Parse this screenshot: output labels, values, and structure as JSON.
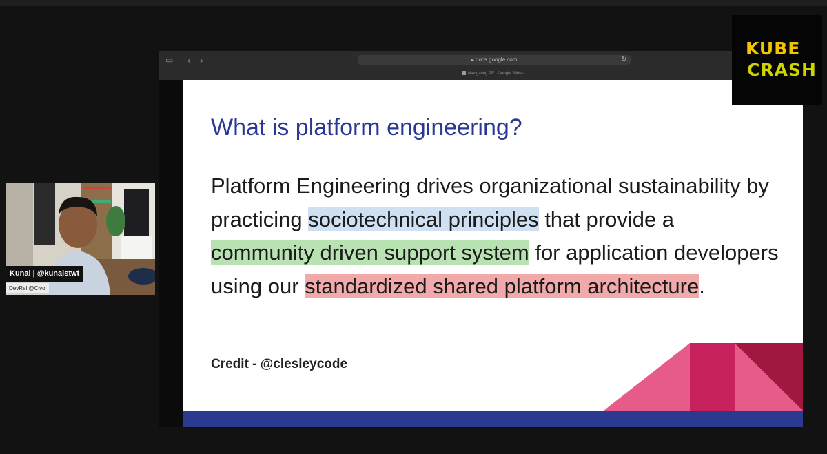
{
  "browser": {
    "url": "docs.google.com",
    "tab_title": "Navigating PE - Google Slides",
    "controls": {
      "sidebar": "▭",
      "back": "‹",
      "forward": "›",
      "reload": "↻"
    }
  },
  "slide": {
    "title": "What is platform engineering?",
    "body": {
      "p1": "Platform Engineering drives organizational sustainability by practicing ",
      "h1": "sociotechnical principles",
      "p2": " that provide a ",
      "h2": "community driven support system",
      "p3": " for application developers using our ",
      "h3": "standardized shared platform architecture",
      "p4": "."
    },
    "credit": "Credit - @clesleycode"
  },
  "presenter": {
    "name": "Kunal | @kunalstwt",
    "role": "DevRel @Civo"
  },
  "logo": {
    "line1": "KUBE",
    "line2": "CRASH"
  },
  "colors": {
    "title": "#2a3894",
    "highlight_blue": "#cfe0f3",
    "highlight_green": "#b9e2b3",
    "highlight_red": "#f1a9a9",
    "bottom_bar": "#2b3a8f",
    "deco_pink": "#e75b8a",
    "deco_magenta": "#c8225e",
    "deco_dark": "#a0183f"
  }
}
